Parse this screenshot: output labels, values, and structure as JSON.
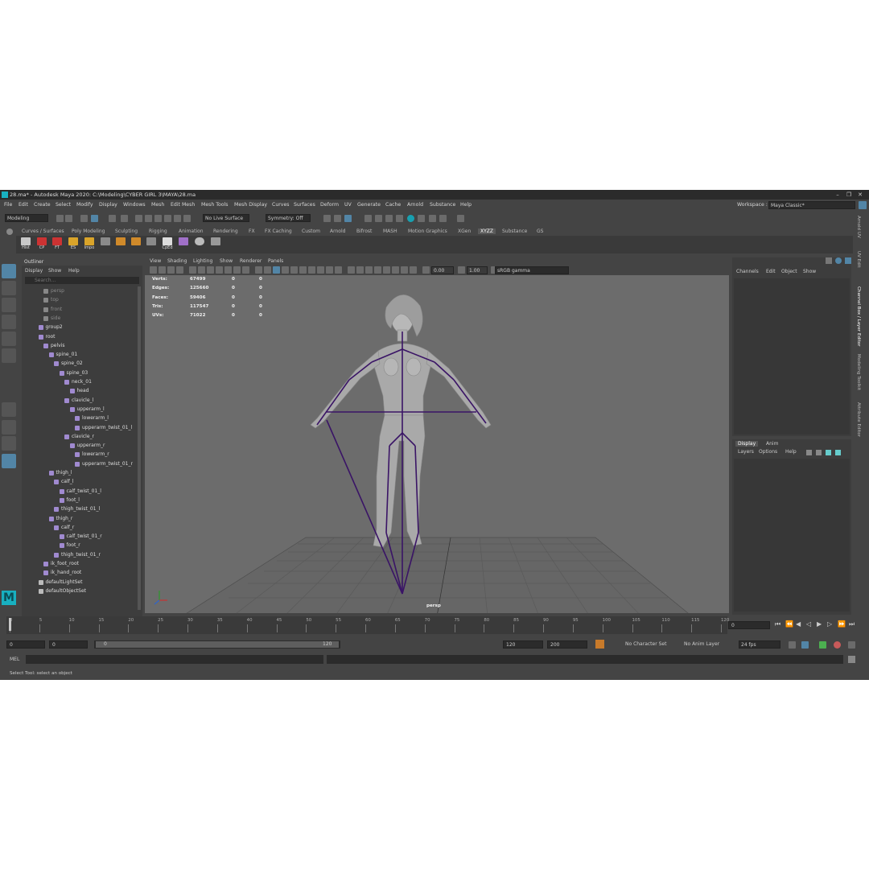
{
  "window": {
    "title": "28.ma* - Autodesk Maya 2020: C:\\Modeling\\CYBER GIRL 3\\MAYA\\28.ma",
    "app_icon": "maya-logo-icon",
    "min_glyph": "–",
    "max_glyph": "❐",
    "close_glyph": "✕"
  },
  "menubar": {
    "items": [
      "File",
      "Edit",
      "Create",
      "Select",
      "Modify",
      "Display",
      "Windows",
      "Mesh",
      "Edit Mesh",
      "Mesh Tools",
      "Mesh Display",
      "Curves",
      "Surfaces",
      "Deform",
      "UV",
      "Generate",
      "Cache",
      "Arnold",
      "Substance",
      "Help"
    ],
    "workspace_label": "Workspace :",
    "workspace_value": "Maya Classic*"
  },
  "statusline": {
    "menu_set": "Modeling",
    "live_surface": "No Live Surface",
    "symmetry": "Symmetry: Off"
  },
  "shelf": {
    "tabs": [
      "Curves / Surfaces",
      "Poly Modeling",
      "Sculpting",
      "Rigging",
      "Animation",
      "Rendering",
      "FX",
      "FX Caching",
      "Custom",
      "Arnold",
      "Bifrost",
      "MASH",
      "Motion Graphics",
      "XGen",
      "XYZZ",
      "Substance",
      "GS"
    ],
    "active_tab": "XYZZ",
    "buttons": [
      "Hist",
      "CP",
      "FT",
      "ES",
      "Impo",
      "",
      "",
      "",
      "",
      "CpEd",
      "",
      ""
    ]
  },
  "outliner": {
    "title": "Outliner",
    "menus": [
      "Display",
      "Show",
      "Help"
    ],
    "search_placeholder": "Search...",
    "items": [
      {
        "label": "persp",
        "dim": true
      },
      {
        "label": "top",
        "dim": true
      },
      {
        "label": "front",
        "dim": true
      },
      {
        "label": "side",
        "dim": true
      },
      {
        "label": "group2",
        "dim": false
      },
      {
        "label": "root",
        "dim": false
      },
      {
        "label": "pelvis",
        "dim": false
      },
      {
        "label": "spine_01",
        "dim": false
      },
      {
        "label": "spine_02",
        "dim": false
      },
      {
        "label": "spine_03",
        "dim": false
      },
      {
        "label": "neck_01",
        "dim": false
      },
      {
        "label": "head",
        "dim": false
      },
      {
        "label": "clavicle_l",
        "dim": false
      },
      {
        "label": "upperarm_l",
        "dim": false
      },
      {
        "label": "lowerarm_l",
        "dim": false
      },
      {
        "label": "upperarm_twist_01_l",
        "dim": false
      },
      {
        "label": "clavicle_r",
        "dim": false
      },
      {
        "label": "upperarm_r",
        "dim": false
      },
      {
        "label": "lowerarm_r",
        "dim": false
      },
      {
        "label": "upperarm_twist_01_r",
        "dim": false
      },
      {
        "label": "thigh_l",
        "dim": false
      },
      {
        "label": "calf_l",
        "dim": false
      },
      {
        "label": "calf_twist_01_l",
        "dim": false
      },
      {
        "label": "foot_l",
        "dim": false
      },
      {
        "label": "thigh_twist_01_l",
        "dim": false
      },
      {
        "label": "thigh_r",
        "dim": false
      },
      {
        "label": "calf_r",
        "dim": false
      },
      {
        "label": "calf_twist_01_r",
        "dim": false
      },
      {
        "label": "foot_r",
        "dim": false
      },
      {
        "label": "thigh_twist_01_r",
        "dim": false
      },
      {
        "label": "ik_foot_root",
        "dim": false
      },
      {
        "label": "ik_hand_root",
        "dim": false
      },
      {
        "label": "defaultLightSet",
        "dim": false
      },
      {
        "label": "defaultObjectSet",
        "dim": false
      }
    ]
  },
  "viewport": {
    "menus": [
      "View",
      "Shading",
      "Lighting",
      "Show",
      "Renderer",
      "Panels"
    ],
    "exposure": "0.00",
    "gamma": "1.00",
    "color_space": "sRGB gamma",
    "camera_label": "persp",
    "hud": [
      {
        "label": "Verts:",
        "v1": "67499",
        "v2": "0",
        "v3": "0"
      },
      {
        "label": "Edges:",
        "v1": "125660",
        "v2": "0",
        "v3": "0"
      },
      {
        "label": "Faces:",
        "v1": "59406",
        "v2": "0",
        "v3": "0"
      },
      {
        "label": "Tris:",
        "v1": "117547",
        "v2": "0",
        "v3": "0"
      },
      {
        "label": "UVs:",
        "v1": "71022",
        "v2": "0",
        "v3": "0"
      }
    ]
  },
  "channel_box": {
    "menus": [
      "Channels",
      "Edit",
      "Object",
      "Show"
    ]
  },
  "layer_editor": {
    "tabs": [
      "Display",
      "Anim"
    ],
    "menus": [
      "Layers",
      "Options",
      "Help"
    ]
  },
  "side_tabs": [
    "Channel Box / Layer Editor",
    "Modeling Toolkit",
    "Attribute Editor"
  ],
  "side_tabs_top": [
    "Arnold UV",
    "UV Edit"
  ],
  "timeline": {
    "ticks": [
      "0",
      "5",
      "10",
      "15",
      "20",
      "25",
      "30",
      "35",
      "40",
      "45",
      "50",
      "55",
      "60",
      "65",
      "70",
      "75",
      "80",
      "85",
      "90",
      "95",
      "100",
      "105",
      "110",
      "115",
      "120"
    ],
    "current_frame": "0"
  },
  "range": {
    "start": "0",
    "playback_start": "0",
    "slider_start": "0",
    "slider_end": "120",
    "playback_end": "120",
    "end": "200",
    "character_set": "No Character Set",
    "anim_layer": "No Anim Layer",
    "fps": "24 fps"
  },
  "command_line": {
    "label": "MEL"
  },
  "help_line": {
    "text": "Select Tool: select an object"
  },
  "colors": {
    "app_bg": "#444444",
    "viewport_bg": "#6c6c6c",
    "joint_color": "#3a1466",
    "accent_blue": "#5285a6",
    "maya_logo": "#18b0c0"
  }
}
